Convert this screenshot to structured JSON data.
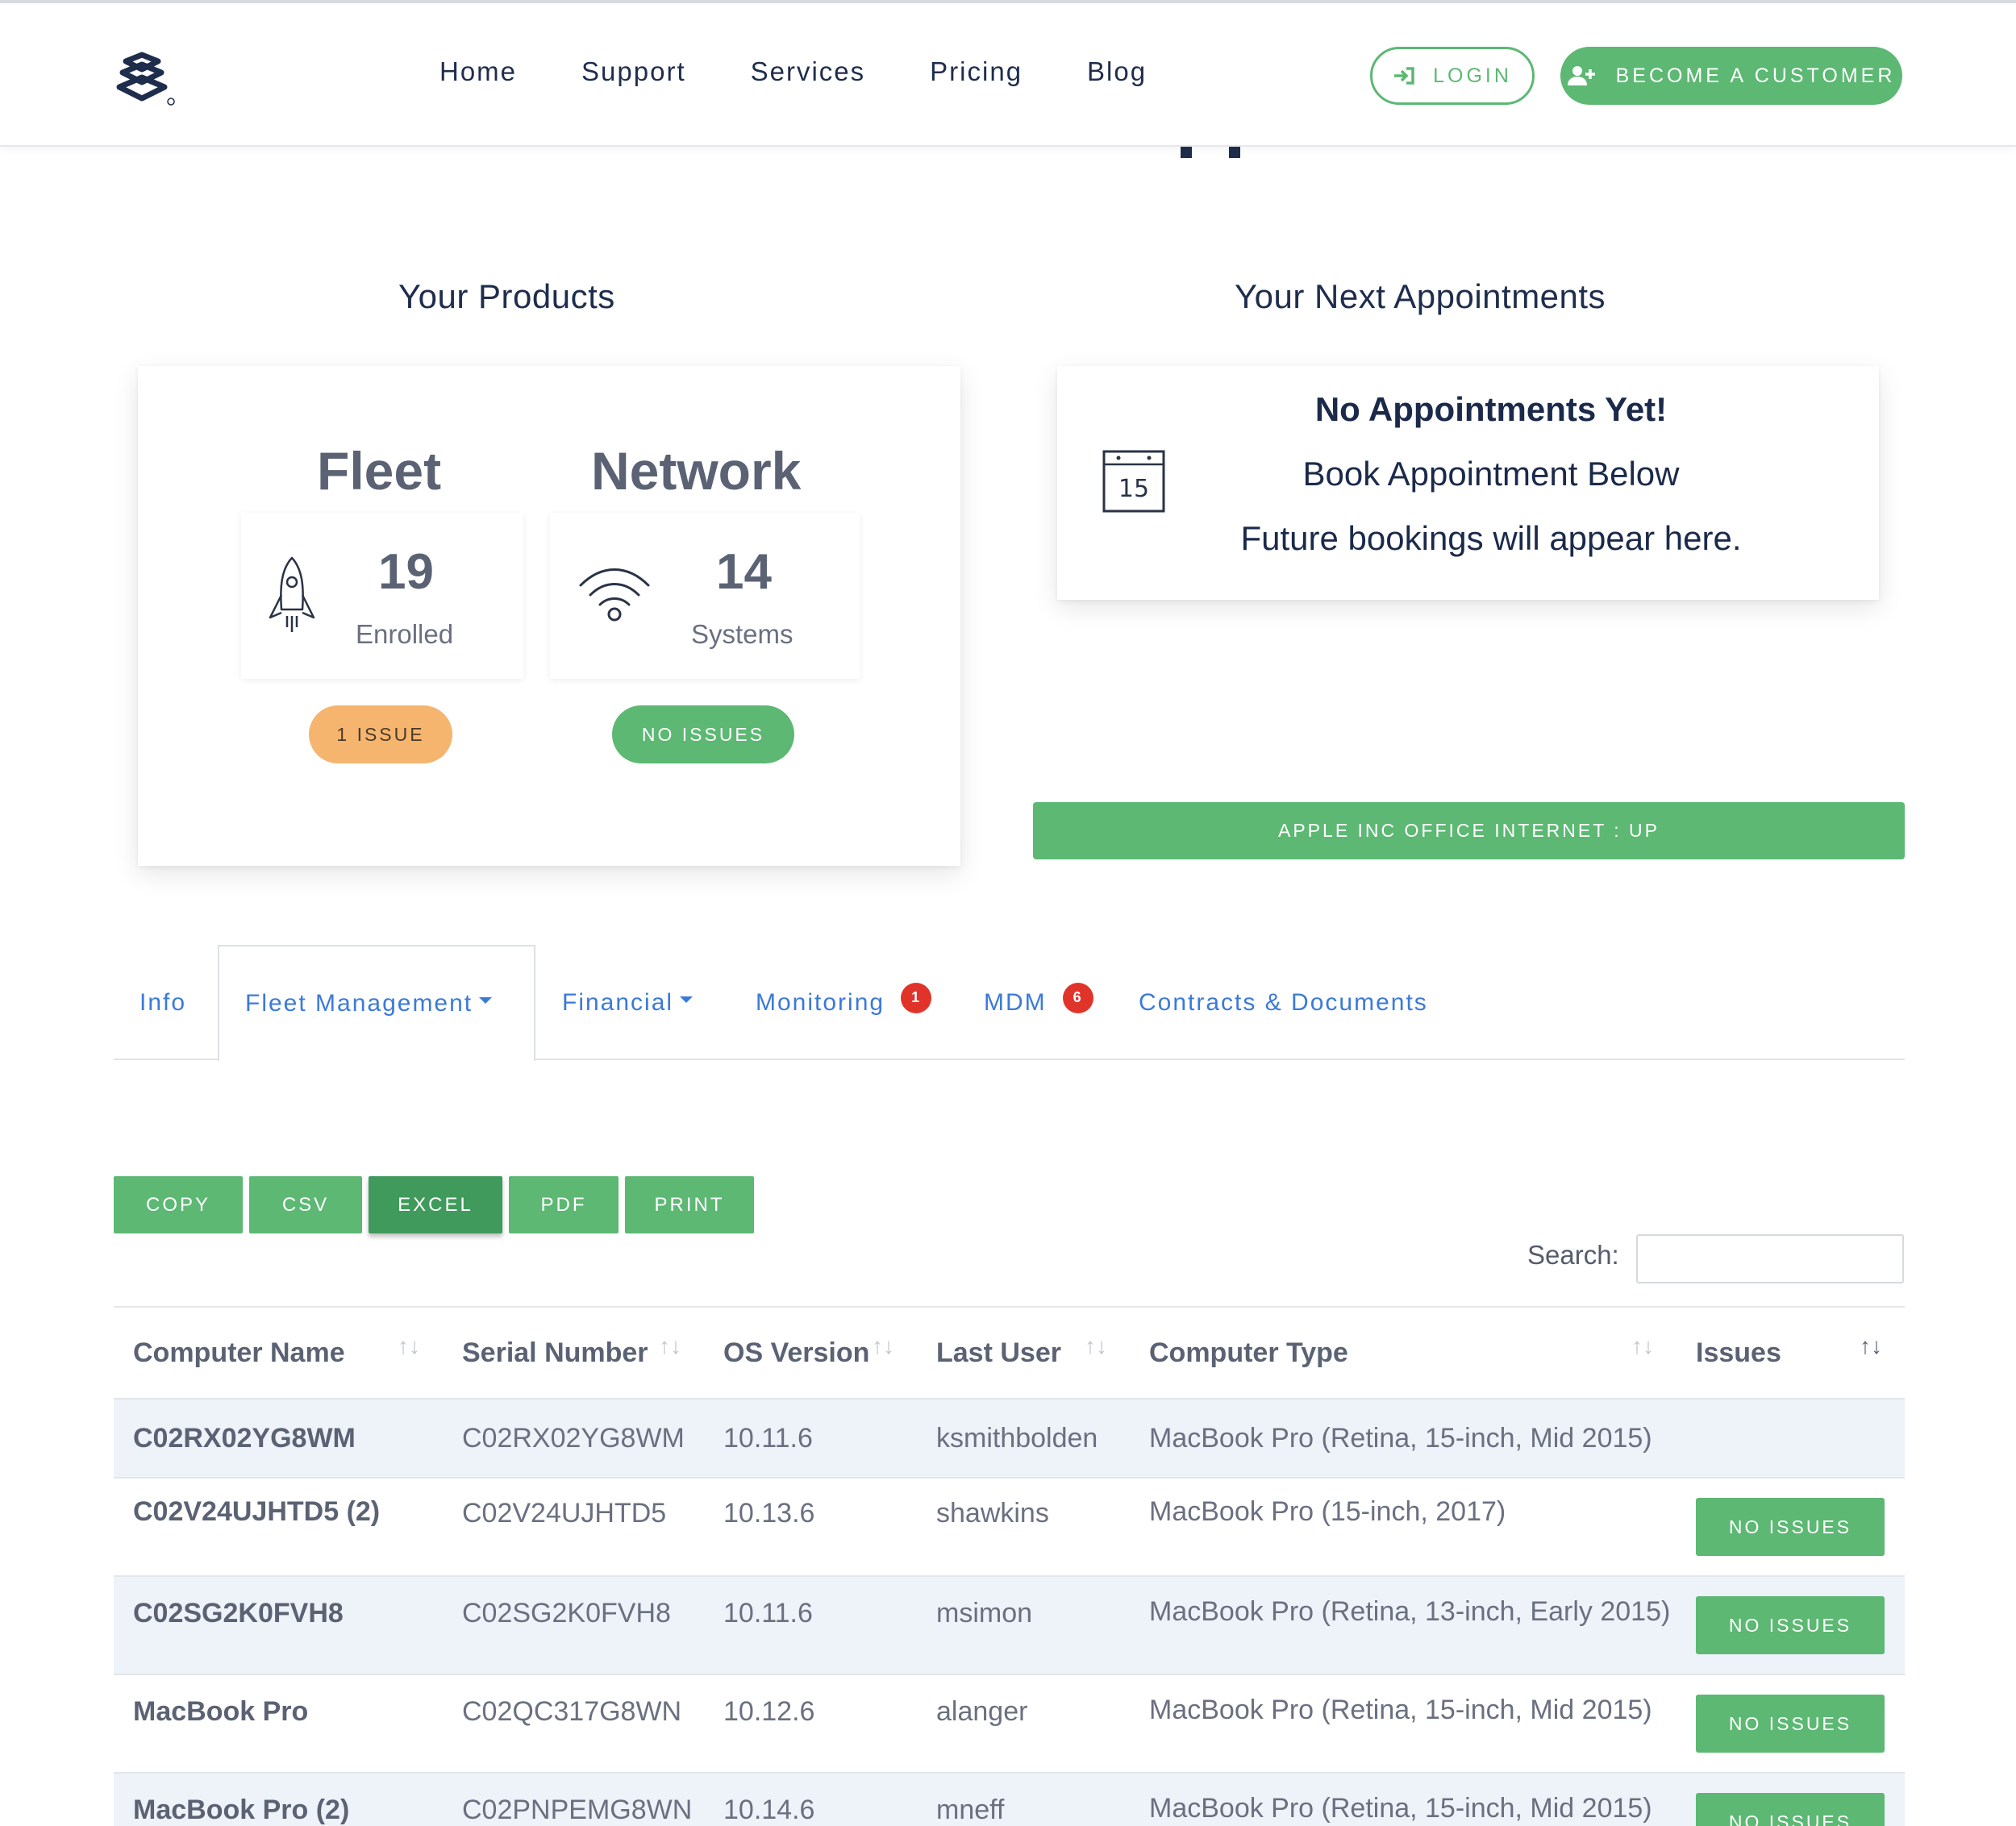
{
  "nav": {
    "items": [
      "Home",
      "Support",
      "Services",
      "Pricing",
      "Blog"
    ],
    "login_label": "LOGIN",
    "become_label": "BECOME A CUSTOMER"
  },
  "products": {
    "title": "Your Products",
    "fleet": {
      "heading": "Fleet",
      "count": "19",
      "caption": "Enrolled",
      "status": "1 ISSUE",
      "status_color": "#f5b56e"
    },
    "network": {
      "heading": "Network",
      "count": "14",
      "caption": "Systems",
      "status": "NO ISSUES",
      "status_color": "#5cb873"
    }
  },
  "appointments": {
    "title": "Your Next Appointments",
    "calendar_day": "15",
    "heading": "No Appointments Yet!",
    "line1": "Book Appointment Below",
    "line2": "Future bookings will appear here."
  },
  "internet_status": "APPLE INC OFFICE INTERNET : UP",
  "tabs": [
    {
      "label": "Info"
    },
    {
      "label": "Fleet Management"
    },
    {
      "label": "Financial"
    },
    {
      "label": "Monitoring",
      "badge": "1"
    },
    {
      "label": "MDM",
      "badge": "6"
    },
    {
      "label": "Contracts & Documents"
    }
  ],
  "export_buttons": [
    "COPY",
    "CSV",
    "EXCEL",
    "PDF",
    "PRINT"
  ],
  "search": {
    "label": "Search:",
    "value": ""
  },
  "table": {
    "columns": [
      "Computer Name",
      "Serial Number",
      "OS Version",
      "Last User",
      "Computer Type",
      "Issues"
    ],
    "rows": [
      {
        "name": "C02RX02YG8WM",
        "serial": "C02RX02YG8WM",
        "os": "10.11.6",
        "user": "ksmithbolden",
        "type": "MacBook Pro (Retina, 15-inch, Mid 2015)",
        "issues": ""
      },
      {
        "name": "C02V24UJHTD5 (2)",
        "serial": "C02V24UJHTD5",
        "os": "10.13.6",
        "user": "shawkins",
        "type": "MacBook Pro (15-inch, 2017)",
        "issues": "NO ISSUES"
      },
      {
        "name": "C02SG2K0FVH8",
        "serial": "C02SG2K0FVH8",
        "os": "10.11.6",
        "user": "msimon",
        "type": "MacBook Pro (Retina, 13-inch, Early 2015)",
        "issues": "NO ISSUES"
      },
      {
        "name": "MacBook Pro",
        "serial": "C02QC317G8WN",
        "os": "10.12.6",
        "user": "alanger",
        "type": "MacBook Pro (Retina, 15-inch, Mid 2015)",
        "issues": "NO ISSUES"
      },
      {
        "name": "MacBook Pro (2)",
        "serial": "C02PNPEMG8WN",
        "os": "10.14.6",
        "user": "mneff",
        "type": "MacBook Pro (Retina, 15-inch, Mid 2015)",
        "issues": "NO ISSUES"
      }
    ]
  },
  "colors": {
    "accent": "#5cb873",
    "link": "#3b7ad9",
    "warning": "#f5b56e",
    "badge": "#e0342b"
  }
}
